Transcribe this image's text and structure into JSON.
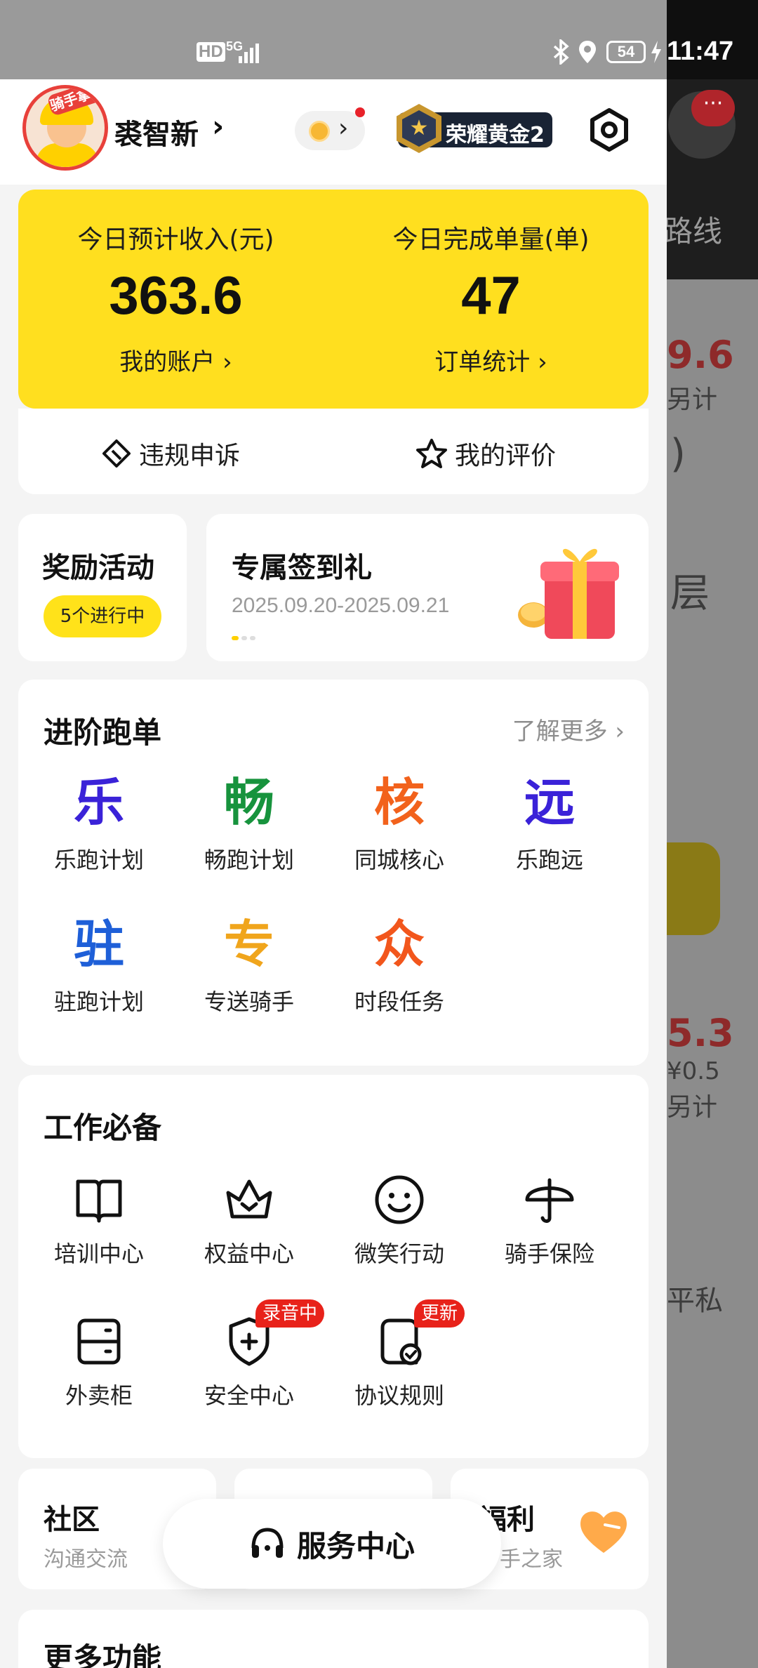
{
  "status_bar": {
    "network_label": "HD",
    "network_type": "5G",
    "battery": "54",
    "time": "11:47"
  },
  "background_page": {
    "tab_text": "路线",
    "amount1": "9.6",
    "amount1_note": "另计",
    "paren": ")",
    "floor_text": "层",
    "amount2": "5.3",
    "amount2_fee": "¥0.5",
    "amount2_note": "另计",
    "privacy_text": "平私",
    "msg_badge": "···"
  },
  "profile": {
    "avatar_badge": "骑手拿超",
    "name": "裘智新",
    "rank": "荣耀黄金2"
  },
  "earnings": {
    "income_label": "今日预计收入(元)",
    "income_value": "363.6",
    "account_link": "我的账户 ›",
    "orders_label": "今日完成单量(单)",
    "orders_value": "47",
    "orders_link": "订单统计 ›"
  },
  "quick_actions": {
    "appeal": "违规申诉",
    "reviews": "我的评价"
  },
  "rewards": {
    "title": "奖励活动",
    "badge": "5个进行中"
  },
  "signin": {
    "title": "专属签到礼",
    "date_range": "2025.09.20-2025.09.21"
  },
  "advanced": {
    "title": "进阶跑单",
    "learn_more": "了解更多",
    "items": [
      {
        "glyph": "乐",
        "label": "乐跑计划",
        "color": "#3a22d8"
      },
      {
        "glyph": "畅",
        "label": "畅跑计划",
        "color": "#17933d"
      },
      {
        "glyph": "核",
        "label": "同城核心",
        "color": "#f2621c"
      },
      {
        "glyph": "远",
        "label": "乐跑远",
        "color": "#3a22d8"
      },
      {
        "glyph": "驻",
        "label": "驻跑计划",
        "color": "#1e5fd8"
      },
      {
        "glyph": "专",
        "label": "专送骑手",
        "color": "#f0a51c"
      },
      {
        "glyph": "众",
        "label": "时段任务",
        "color": "#f2561c"
      }
    ]
  },
  "work": {
    "title": "工作必备",
    "items": [
      {
        "icon": "book-icon",
        "label": "培训中心"
      },
      {
        "icon": "crown-icon",
        "label": "权益中心"
      },
      {
        "icon": "smile-icon",
        "label": "微笑行动"
      },
      {
        "icon": "umbrella-icon",
        "label": "骑手保险"
      },
      {
        "icon": "locker-icon",
        "label": "外卖柜"
      },
      {
        "icon": "shield-icon",
        "label": "安全中心",
        "tag": "录音中"
      },
      {
        "icon": "document-check-icon",
        "label": "协议规则",
        "tag": "更新"
      }
    ]
  },
  "bottom_cards": {
    "community_title": "社区",
    "community_sub": "沟通交流",
    "welfare_title": "福利",
    "welfare_sub": "手之家"
  },
  "service_center": {
    "label": "服务中心"
  },
  "more": {
    "title": "更多功能"
  },
  "colors": {
    "brand_yellow": "#ffdf1f",
    "tag_red": "#e8221a",
    "rank_bg": "#192334"
  }
}
